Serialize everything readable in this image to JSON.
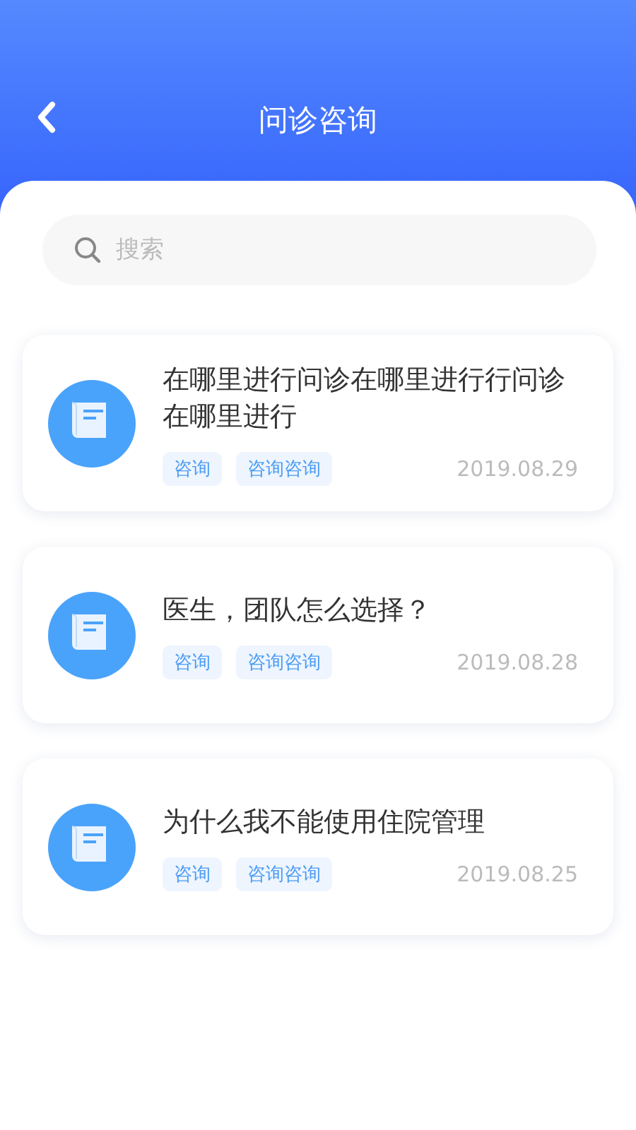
{
  "header": {
    "title": "问诊咨询"
  },
  "search": {
    "placeholder": "搜索"
  },
  "items": [
    {
      "title": "在哪里进行问诊在哪里进行行问诊在哪里进行",
      "tags": [
        "咨询",
        "咨询咨询"
      ],
      "date": "2019.08.29"
    },
    {
      "title": "医生，团队怎么选择？",
      "tags": [
        "咨询",
        "咨询咨询"
      ],
      "date": "2019.08.28"
    },
    {
      "title": "为什么我不能使用住院管理",
      "tags": [
        "咨询",
        "咨询咨询"
      ],
      "date": "2019.08.25"
    }
  ]
}
